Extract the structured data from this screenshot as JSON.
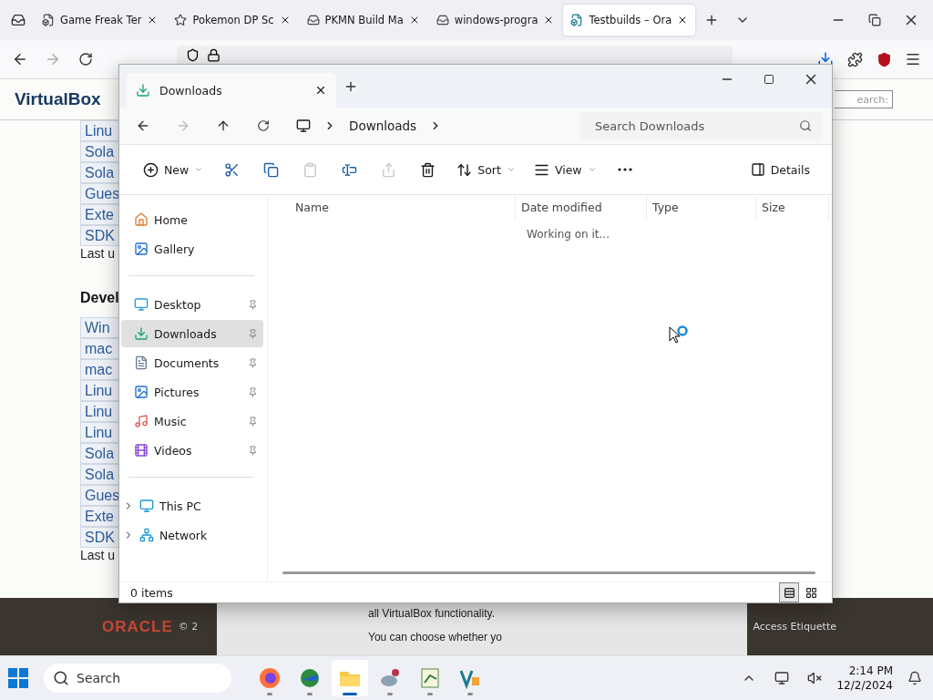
{
  "browser": {
    "tabs": [
      {
        "kind": "page",
        "label": "Game Freak Ter",
        "selected": false
      },
      {
        "kind": "game",
        "label": "Pokemon DP Sc",
        "selected": false
      },
      {
        "kind": "archive",
        "label": "PKMN Build Ma",
        "selected": false
      },
      {
        "kind": "archive",
        "label": "windows-progra",
        "selected": false
      },
      {
        "kind": "vbox",
        "label": "Testbuilds – Ora",
        "selected": true
      }
    ],
    "page": {
      "logo": "VirtualBox",
      "search_hint": "earch:",
      "links_top": [
        "Linu",
        "Sola",
        "Sola",
        "Gues",
        "Exte",
        "SDK"
      ],
      "note_top": "Last u",
      "heading": "Devel",
      "links_bottom": [
        "Win",
        "mac",
        "mac",
        "Linu",
        "Linu",
        "Linu",
        "Sola",
        "Sola",
        "Gues",
        "Exte",
        "SDK"
      ],
      "note_bottom": "Last u",
      "footer": {
        "logo": "ORACLE",
        "copyright": "© 2",
        "notice": [
          "all VirtualBox functionality.",
          "You can choose whether yo"
        ],
        "link": "Access Etiquette"
      }
    }
  },
  "explorer": {
    "tab": "Downloads",
    "address": "Downloads",
    "search": {
      "placeholder": "Search Downloads"
    },
    "toolbar": [
      {
        "kind": "new",
        "label": "New",
        "disabled": false
      },
      {
        "kind": "cut",
        "disabled": false
      },
      {
        "kind": "copy",
        "disabled": false
      },
      {
        "kind": "paste",
        "disabled": true
      },
      {
        "kind": "rename",
        "disabled": false
      },
      {
        "kind": "share",
        "disabled": true
      },
      {
        "kind": "delete",
        "disabled": false
      },
      {
        "kind": "sort",
        "label": "Sort",
        "disabled": false
      },
      {
        "kind": "view",
        "label": "View",
        "disabled": false
      },
      {
        "kind": "more",
        "disabled": false
      }
    ],
    "details_button": "Details",
    "sidebar": [
      [
        {
          "kind": "home",
          "label": "Home",
          "pinned": false,
          "selected": false
        },
        {
          "kind": "gallery",
          "label": "Gallery",
          "pinned": false,
          "selected": false
        }
      ],
      [
        {
          "kind": "desktop",
          "label": "Desktop",
          "pinned": true,
          "selected": false
        },
        {
          "kind": "downloads",
          "label": "Downloads",
          "pinned": true,
          "selected": true
        },
        {
          "kind": "documents",
          "label": "Documents",
          "pinned": true,
          "selected": false
        },
        {
          "kind": "pictures",
          "label": "Pictures",
          "pinned": true,
          "selected": false
        },
        {
          "kind": "music",
          "label": "Music",
          "pinned": true,
          "selected": false
        },
        {
          "kind": "videos",
          "label": "Videos",
          "pinned": true,
          "selected": false
        }
      ],
      [
        {
          "kind": "pc",
          "label": "This PC",
          "expanded": false,
          "selected": false
        },
        {
          "kind": "network",
          "label": "Network",
          "expanded": false,
          "selected": false
        }
      ]
    ],
    "columns": [
      "Name",
      "Date modified",
      "Type",
      "Size"
    ],
    "message": "Working on it...",
    "status_bar": "0 items",
    "views": [
      {
        "kind": "details",
        "selected": true
      },
      {
        "kind": "tiles",
        "selected": false
      }
    ]
  },
  "taskbar": {
    "search": {
      "placeholder": "Search"
    },
    "apps": [
      {
        "kind": "firefox",
        "selected": false
      },
      {
        "kind": "globe",
        "selected": false
      },
      {
        "kind": "folder",
        "selected": true
      },
      {
        "kind": "turtle",
        "selected": false
      },
      {
        "kind": "notes",
        "selected": false
      },
      {
        "kind": "vbox",
        "selected": false
      }
    ],
    "time": "2:14 PM",
    "date": "12/2/2024"
  }
}
